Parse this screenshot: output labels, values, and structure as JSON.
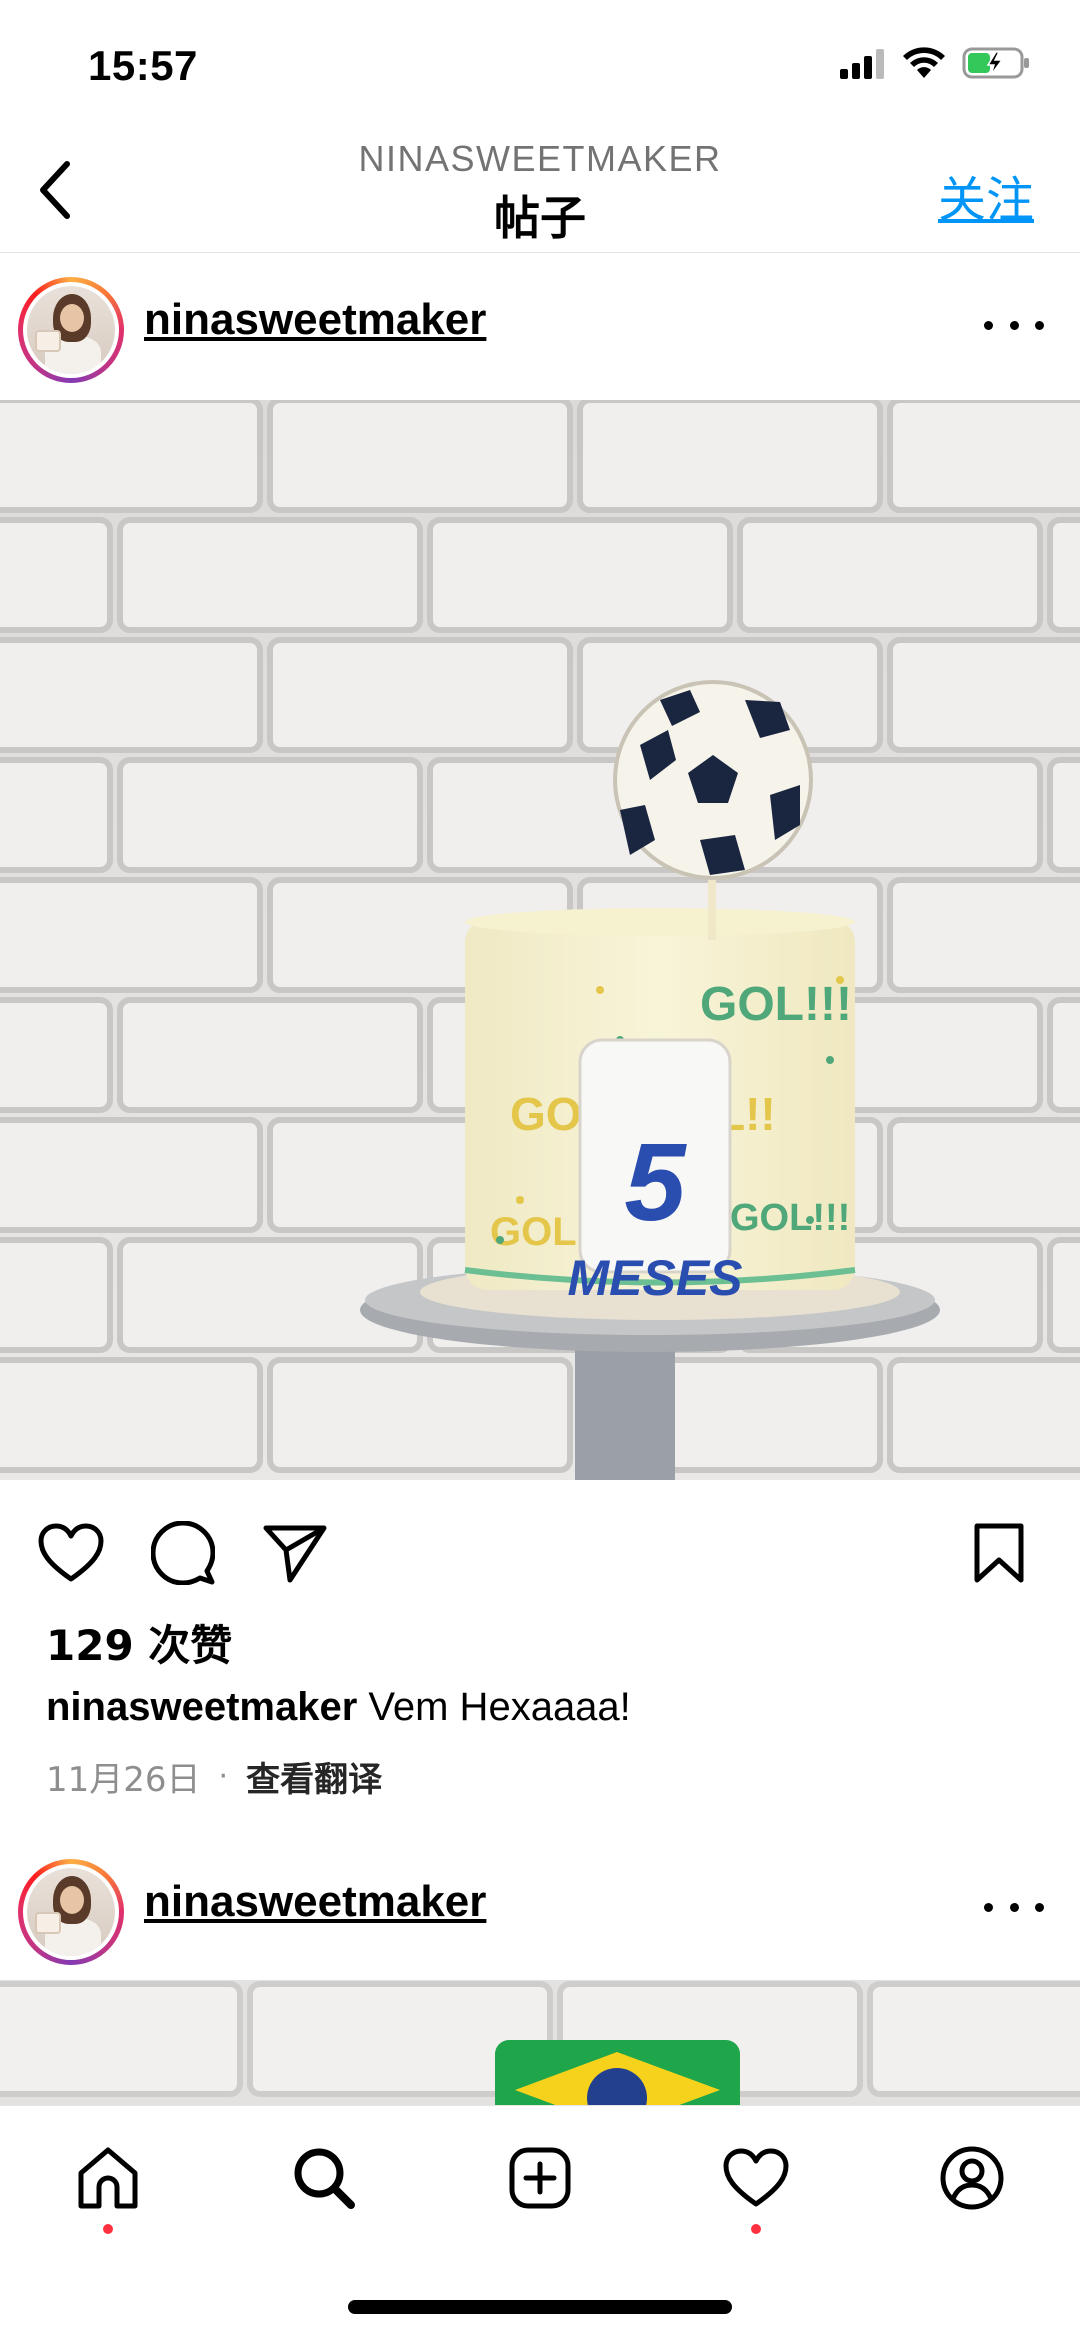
{
  "status_bar": {
    "time": "15:57"
  },
  "header": {
    "account": "NINASWEETMAKER",
    "title": "帖子",
    "follow_label": "关注"
  },
  "post": {
    "username": "ninasweetmaker",
    "image_description_text": {
      "topper_number": "5",
      "topper_word": "MESES",
      "cake_writing": [
        "GOL!!!",
        "GOOOOLL!!",
        "GOL!!!",
        "GOL!"
      ]
    },
    "likes": "129 次赞",
    "caption_user": "ninasweetmaker",
    "caption_text": "Vem Hexaaaa!",
    "date": "11月26日",
    "separator": "·",
    "translate_label": "查看翻译"
  },
  "next_post": {
    "username": "ninasweetmaker"
  },
  "tab_bar": {
    "items": [
      "home-icon",
      "search-icon",
      "create-icon",
      "activity-icon",
      "profile-icon"
    ],
    "badge_color": "#ff3040"
  },
  "colors": {
    "accent": "#0095f6",
    "meta": "#8e8e8e"
  }
}
